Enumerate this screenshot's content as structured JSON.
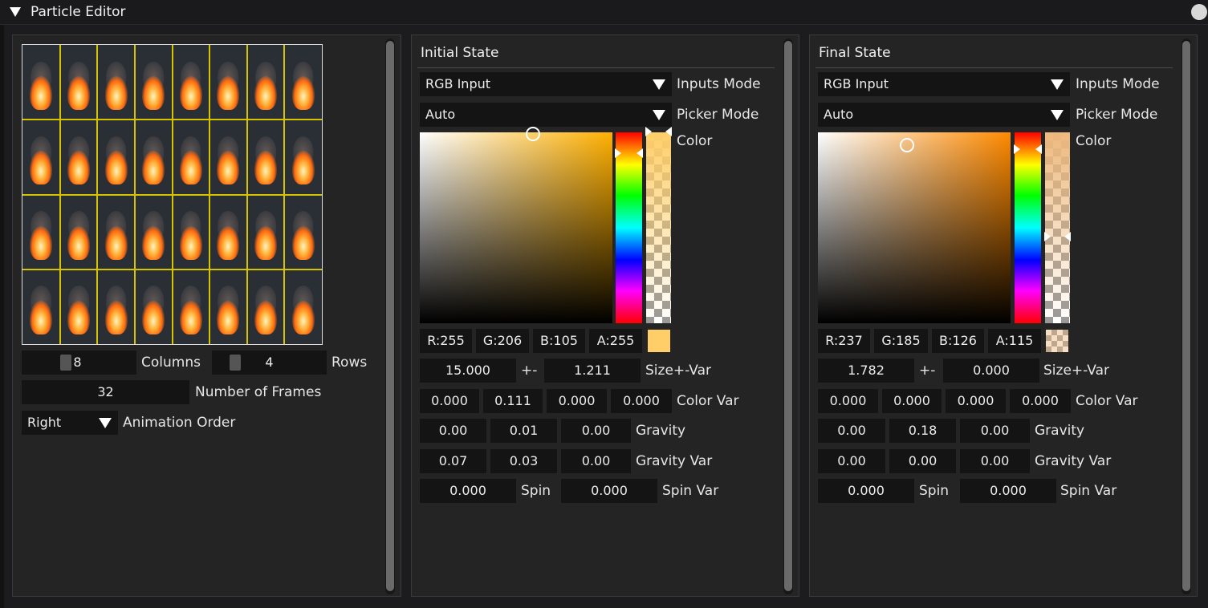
{
  "window": {
    "title": "Particle Editor"
  },
  "sprite": {
    "columns": "8",
    "columns_label": "Columns",
    "rows": "4",
    "rows_label": "Rows",
    "frames": "32",
    "frames_label": "Number of Frames",
    "order": "Right",
    "order_label": "Animation Order"
  },
  "initial": {
    "title": "Initial State",
    "inputs_mode": "RGB Input",
    "inputs_mode_label": "Inputs Mode",
    "picker_mode": "Auto",
    "picker_mode_label": "Picker Mode",
    "color_label": "Color",
    "r": "R:255",
    "g": "G:206",
    "b": "B:105",
    "a": "A:255",
    "swatch_color": "#ffce69",
    "hue_color": "#ffb000",
    "size": "15.000",
    "pm": "+-",
    "size_var": "1.211",
    "size_label": "Size+-Var",
    "cv1": "0.000",
    "cv2": "0.111",
    "cv3": "0.000",
    "cv4": "0.000",
    "color_var_label": "Color Var",
    "g1": "0.00",
    "g2": "0.01",
    "g3": "0.00",
    "gravity_label": "Gravity",
    "gv1": "0.07",
    "gv2": "0.03",
    "gv3": "0.00",
    "gravity_var_label": "Gravity Var",
    "spin": "0.000",
    "spin_label": "Spin",
    "spin_var": "0.000",
    "spin_var_label": "Spin Var"
  },
  "final": {
    "title": "Final State",
    "inputs_mode": "RGB Input",
    "inputs_mode_label": "Inputs Mode",
    "picker_mode": "Auto",
    "picker_mode_label": "Picker Mode",
    "color_label": "Color",
    "r": "R:237",
    "g": "G:185",
    "b": "B:126",
    "a": "A:115",
    "swatch_color": "#edb97e",
    "hue_color": "#ff8a00",
    "size": "1.782",
    "pm": "+-",
    "size_var": "0.000",
    "size_label": "Size+-Var",
    "cv1": "0.000",
    "cv2": "0.000",
    "cv3": "0.000",
    "cv4": "0.000",
    "color_var_label": "Color Var",
    "g1": "0.00",
    "g2": "0.18",
    "g3": "0.00",
    "gravity_label": "Gravity",
    "gv1": "0.00",
    "gv2": "0.00",
    "gv3": "0.00",
    "gravity_var_label": "Gravity Var",
    "spin": "0.000",
    "spin_label": "Spin",
    "spin_var": "0.000",
    "spin_var_label": "Spin Var"
  },
  "icons": [
    "collapse-arrow-icon",
    "dropdown-arrow-icon",
    "close-icon"
  ]
}
